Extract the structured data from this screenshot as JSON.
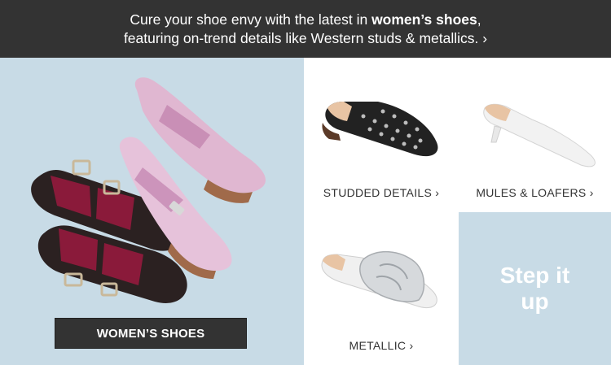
{
  "banner": {
    "line1_prefix": "Cure your shoe envy with the latest in ",
    "line1_bold": "women’s shoes",
    "line1_suffix": ",",
    "line2": "featuring on-trend details like Western studs & metallics. ›"
  },
  "hero": {
    "button_label": "WOMEN’S SHOES"
  },
  "tiles": [
    {
      "label": "STUDDED DETAILS ›"
    },
    {
      "label": "MULES & LOAFERS ›"
    },
    {
      "label": "METALLIC ›"
    }
  ],
  "promo": {
    "text": "Step it up"
  },
  "colors": {
    "banner_bg": "#333333",
    "hero_bg": "#c8dbe6",
    "button_bg": "#333333",
    "promo_bg": "#c8dbe6"
  }
}
